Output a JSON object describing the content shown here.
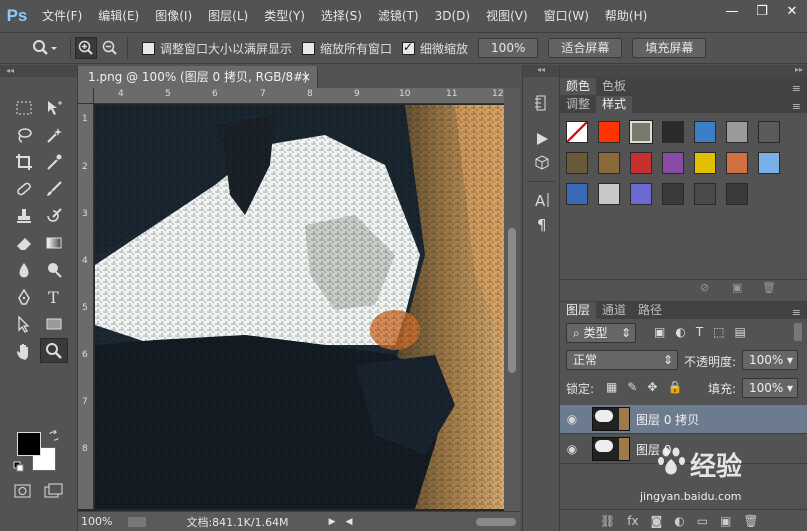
{
  "app": {
    "logo": "Ps"
  },
  "menu": [
    "文件(F)",
    "编辑(E)",
    "图像(I)",
    "图层(L)",
    "类型(Y)",
    "选择(S)",
    "滤镜(T)",
    "3D(D)",
    "视图(V)",
    "窗口(W)",
    "帮助(H)"
  ],
  "window_controls": {
    "minimize": "—",
    "restore": "❐",
    "close": "✕"
  },
  "options": {
    "resize_windows": "调整窗口大小以满屏显示",
    "resize_windows_checked": false,
    "zoom_all_windows": "缩放所有窗口",
    "zoom_all_windows_checked": false,
    "scrubby_zoom": "细微缩放",
    "scrubby_zoom_checked": true,
    "zoom_100": "100%",
    "fit_screen": "适合屏幕",
    "fill_screen": "填充屏幕"
  },
  "document": {
    "tab_title": "1.png @ 100% (图层 0 拷贝, RGB/8#) *",
    "close": "×",
    "ruler_top": [
      "4",
      "5",
      "6",
      "7",
      "8",
      "9",
      "10",
      "11",
      "12"
    ],
    "ruler_left": [
      "1",
      "2",
      "3",
      "4",
      "5",
      "6",
      "7",
      "8"
    ],
    "status_zoom": "100%",
    "status_doc": "文档:841.1K/1.64M"
  },
  "color_panel": {
    "tabs": [
      "颜色",
      "色板"
    ],
    "tabs2": [
      "调整",
      "样式"
    ],
    "active_tab2": "样式"
  },
  "styles_swatches": [
    "#e8e8e8",
    "#ff3300",
    "#7a7a6a",
    "#2a2a2a",
    "#3a7ec8",
    "#9a9a9a",
    "#5a5a5a",
    "#6a5a3a",
    "#8a6a3a",
    "#c83030",
    "#8a4aa8",
    "#e0c000",
    "#d07040",
    "#7ab0e8",
    "#3a6ab8",
    "#c8c8c8",
    "#6a6ad0",
    "#3a3a3a",
    "#4a4a4a",
    "#3a3a3a"
  ],
  "layers_panel": {
    "tabs": [
      "图层",
      "通道",
      "路径"
    ],
    "filter_kind": "类型",
    "blend_mode": "正常",
    "opacity_label": "不透明度:",
    "opacity_value": "100%",
    "lock_label": "锁定:",
    "fill_label": "填充:",
    "fill_value": "100%",
    "layers": [
      {
        "name": "图层 0 拷贝",
        "selected": true
      },
      {
        "name": "图层 0",
        "selected": false
      }
    ]
  },
  "watermark": {
    "brand": "经验",
    "url": "jingyan.baidu.com"
  }
}
